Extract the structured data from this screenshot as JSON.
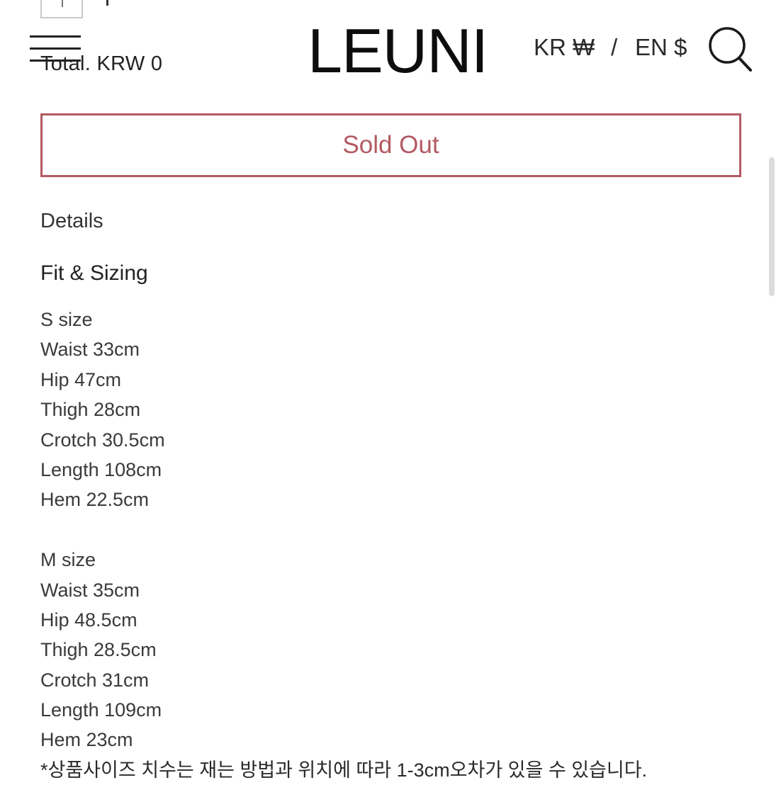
{
  "header": {
    "total_text": "Total. KRW 0",
    "logo_text": "LEUNI",
    "currency_kr": "KR ₩",
    "currency_separator": "/",
    "currency_en": "EN $",
    "menu_icon": "hamburger-menu-icon",
    "search_icon": "search-icon"
  },
  "product": {
    "sold_out_label": "Sold Out",
    "sold_out_color": "#b35a63",
    "details_label": "Details",
    "fit_title": "Fit & Sizing",
    "s_size": [
      "S size",
      "Waist 33cm",
      "Hip 47cm",
      "Thigh 28cm",
      "Crotch 30.5cm",
      "Length 108cm",
      "Hem 22.5cm"
    ],
    "m_size": [
      "M size",
      "Waist 35cm",
      "Hip 48.5cm",
      "Thigh 28.5cm",
      "Crotch 31cm",
      "Length 109cm",
      "Hem 23cm"
    ],
    "note": "*상품사이즈 치수는 재는 방법과 위치에 따라 1-3cm오차가 있을 수 있습니다."
  }
}
